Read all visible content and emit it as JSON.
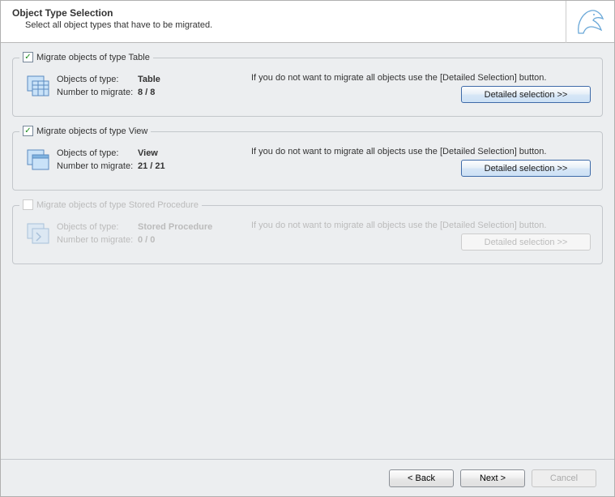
{
  "header": {
    "title": "Object Type Selection",
    "subtitle": "Select all object types that have to be migrated."
  },
  "labels": {
    "objects_of_type": "Objects of type:",
    "number_to_migrate": "Number to migrate:",
    "hint": "If you do not want to migrate all objects use the [Detailed Selection] button.",
    "detailed_selection": "Detailed selection >>"
  },
  "groups": [
    {
      "legend": "Migrate objects of type Table",
      "checked": true,
      "enabled": true,
      "type_name": "Table",
      "count": "8 / 8"
    },
    {
      "legend": "Migrate objects of type View",
      "checked": true,
      "enabled": true,
      "type_name": "View",
      "count": "21 / 21"
    },
    {
      "legend": "Migrate objects of type Stored Procedure",
      "checked": false,
      "enabled": false,
      "type_name": "Stored Procedure",
      "count": "0 / 0"
    }
  ],
  "footer": {
    "back": "< Back",
    "next": "Next >",
    "cancel": "Cancel"
  }
}
